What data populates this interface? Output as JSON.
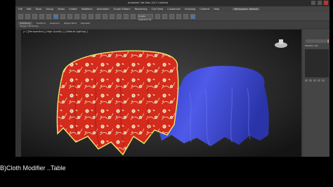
{
  "window": {
    "title": "Autodesk 3ds Max 2017   Untitled",
    "workspace": "Workspace: Default"
  },
  "menu": {
    "items": [
      "File",
      "Edit",
      "Tools",
      "Group",
      "Views",
      "Create",
      "Modifiers",
      "Animation",
      "Graph Editors",
      "Rendering",
      "Civil View",
      "Customize",
      "Scripting",
      "Content",
      "Help"
    ]
  },
  "toolbar": {
    "selection_set": "Create Selection Se"
  },
  "ribbon": {
    "tabs": [
      "Modeling",
      "Freeform",
      "Selection",
      "Object Paint",
      "Populate"
    ],
    "active_tab": "Modeling",
    "panel_label": "Polygon Modeling"
  },
  "viewport": {
    "label": "[+] [Perspective] [ High Quality ] [ Default Lighting ]"
  },
  "command_panel": {
    "modifier_list_label": "Modifier List"
  },
  "caption": "B)Cloth Modifier ..Table",
  "colors": {
    "red_cloth": "#d42b1c",
    "blue_cloth": "#3b48d6",
    "selection_outline": "#f2e46b"
  }
}
